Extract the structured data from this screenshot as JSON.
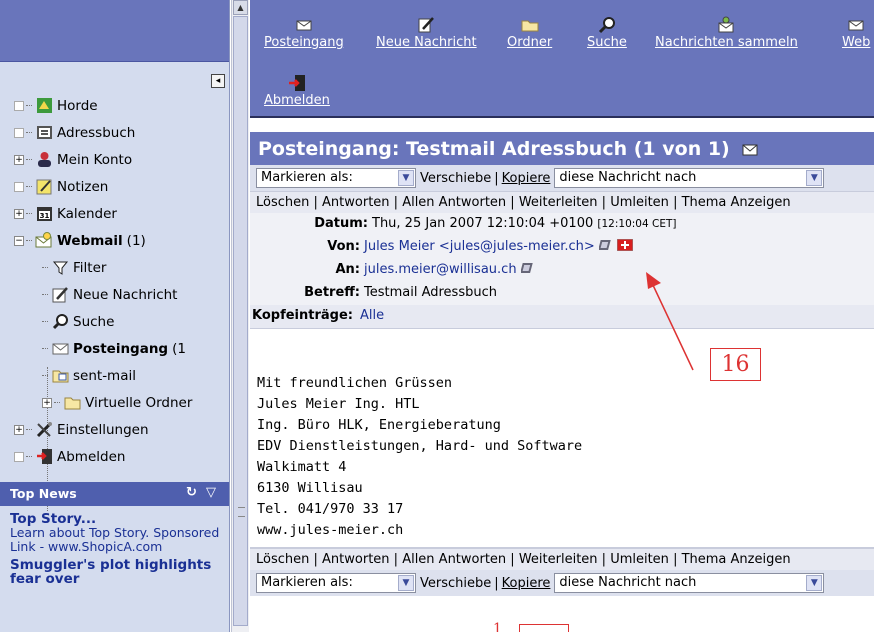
{
  "sidebar": {
    "tree": [
      {
        "label": "Horde",
        "icon": "horde-icon",
        "expander": "plain"
      },
      {
        "label": "Adressbuch",
        "icon": "addressbook-icon",
        "expander": "plain"
      },
      {
        "label": "Mein Konto",
        "icon": "user-icon",
        "expander": "+"
      },
      {
        "label": "Notizen",
        "icon": "notes-icon",
        "expander": "plain"
      },
      {
        "label": "Kalender",
        "icon": "calendar-icon",
        "expander": "+"
      },
      {
        "label": "Webmail",
        "count": "(1)",
        "icon": "webmail-icon",
        "expander": "-"
      },
      {
        "label": "Filter",
        "icon": "filter-icon"
      },
      {
        "label": "Neue Nachricht",
        "icon": "compose-icon"
      },
      {
        "label": "Suche",
        "icon": "search-icon"
      },
      {
        "label": "Posteingang",
        "count": "(1",
        "icon": "inbox-icon"
      },
      {
        "label": "sent-mail",
        "icon": "sent-icon"
      },
      {
        "label": "Virtuelle Ordner",
        "icon": "folder-icon",
        "expander": "+"
      },
      {
        "label": "Einstellungen",
        "icon": "settings-icon",
        "expander": "+"
      },
      {
        "label": "Abmelden",
        "icon": "logout-icon",
        "expander": "plain"
      }
    ],
    "calendar_icon_text": "31",
    "top_news": {
      "header": "Top News",
      "story_title": "Top Story...",
      "story_text": "Learn about Top Story. Sponsored Link - www.ShopicA.com",
      "story2_title": "Smuggler's plot highlights fear over"
    }
  },
  "toolbar": {
    "items": [
      {
        "label": "Posteingang",
        "icon": "inbox-icon"
      },
      {
        "label": "Neue Nachricht",
        "icon": "compose-icon"
      },
      {
        "label": "Ordner",
        "icon": "folder-icon"
      },
      {
        "label": "Suche",
        "icon": "search-icon"
      },
      {
        "label": "Nachrichten sammeln",
        "icon": "fetch-mail-icon"
      },
      {
        "label": "Web",
        "icon": "webmail-icon"
      }
    ],
    "logout_label": "Abmelden"
  },
  "message": {
    "title": "Posteingang: Testmail Adressbuch (1 von 1)",
    "mark_as_label": "Markieren als:",
    "move_label": "Verschiebe",
    "copy_label": "Kopiere",
    "target_label": "diese Nachricht nach",
    "actions": [
      "Löschen",
      "Antworten",
      "Allen Antworten",
      "Weiterleiten",
      "Umleiten",
      "Thema Anzeigen"
    ],
    "date_label": "Datum:",
    "date_value": "Thu, 25 Jan 2007 12:10:04 +0100",
    "date_local": "[12:10:04 CET]",
    "from_label": "Von:",
    "from_value": "Jules Meier <jules@jules-meier.ch>",
    "to_label": "An:",
    "to_value": "jules.meier@willisau.ch",
    "subject_label": "Betreff:",
    "subject_value": "Testmail Adressbuch",
    "headers_label": "Kopfeinträge:",
    "headers_value": "Alle",
    "body": "Mit freundlichen Grüssen\nJules Meier Ing. HTL\nIng. Büro HLK, Energieberatung\nEDV Dienstleistungen, Hard- und Software\nWalkimatt 4\n6130 Willisau\nTel. 041/970 33 17\nwww.jules-meier.ch"
  },
  "annotation": {
    "callout_number": "16",
    "callout_2_text": "1",
    "color": "#dd3333"
  }
}
